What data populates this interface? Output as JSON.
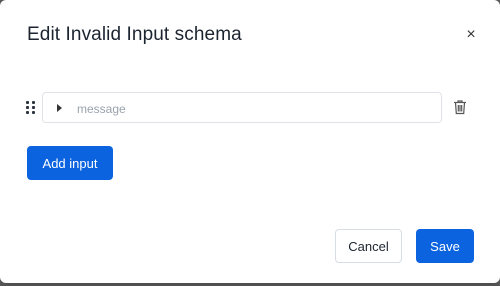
{
  "modal": {
    "title": "Edit Invalid Input schema",
    "close_symbol": "×"
  },
  "inputs": [
    {
      "placeholder": "message",
      "value": ""
    }
  ],
  "buttons": {
    "add_input": "Add input",
    "cancel": "Cancel",
    "save": "Save"
  },
  "icons": {
    "close": "close-icon",
    "drag": "drag-handle-icon",
    "expand": "caret-right-icon",
    "delete": "trash-icon"
  },
  "colors": {
    "primary": "#0b63e0",
    "title_text": "#1c2430",
    "border": "#dfe3e8"
  }
}
